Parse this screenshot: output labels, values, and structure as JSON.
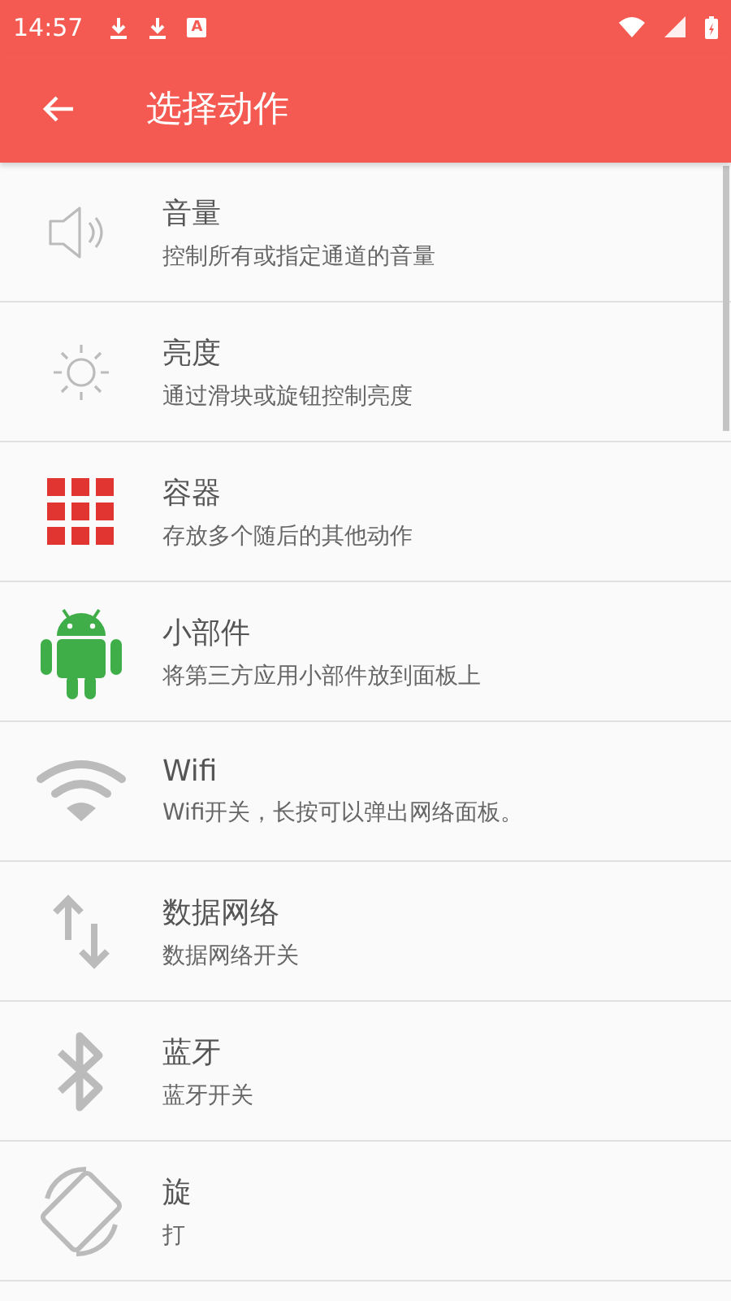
{
  "status_bar": {
    "time": "14:57",
    "keyboard_badge": "A"
  },
  "toolbar": {
    "title": "选择动作"
  },
  "actions": [
    {
      "kind": "volume",
      "title": "音量",
      "subtitle": "控制所有或指定通道的音量"
    },
    {
      "kind": "brightness",
      "title": "亮度",
      "subtitle": "通过滑块或旋钮控制亮度"
    },
    {
      "kind": "container",
      "title": "容器",
      "subtitle": "存放多个随后的其他动作"
    },
    {
      "kind": "widget",
      "title": "小部件",
      "subtitle": "将第三方应用小部件放到面板上"
    },
    {
      "kind": "wifi",
      "title": "Wifi",
      "subtitle": "Wifi开关，长按可以弹出网络面板。"
    },
    {
      "kind": "data",
      "title": "数据网络",
      "subtitle": "数据网络开关"
    },
    {
      "kind": "bluetooth",
      "title": "蓝牙",
      "subtitle": "蓝牙开关"
    },
    {
      "kind": "rotation",
      "title": "旋",
      "subtitle": "打"
    }
  ]
}
